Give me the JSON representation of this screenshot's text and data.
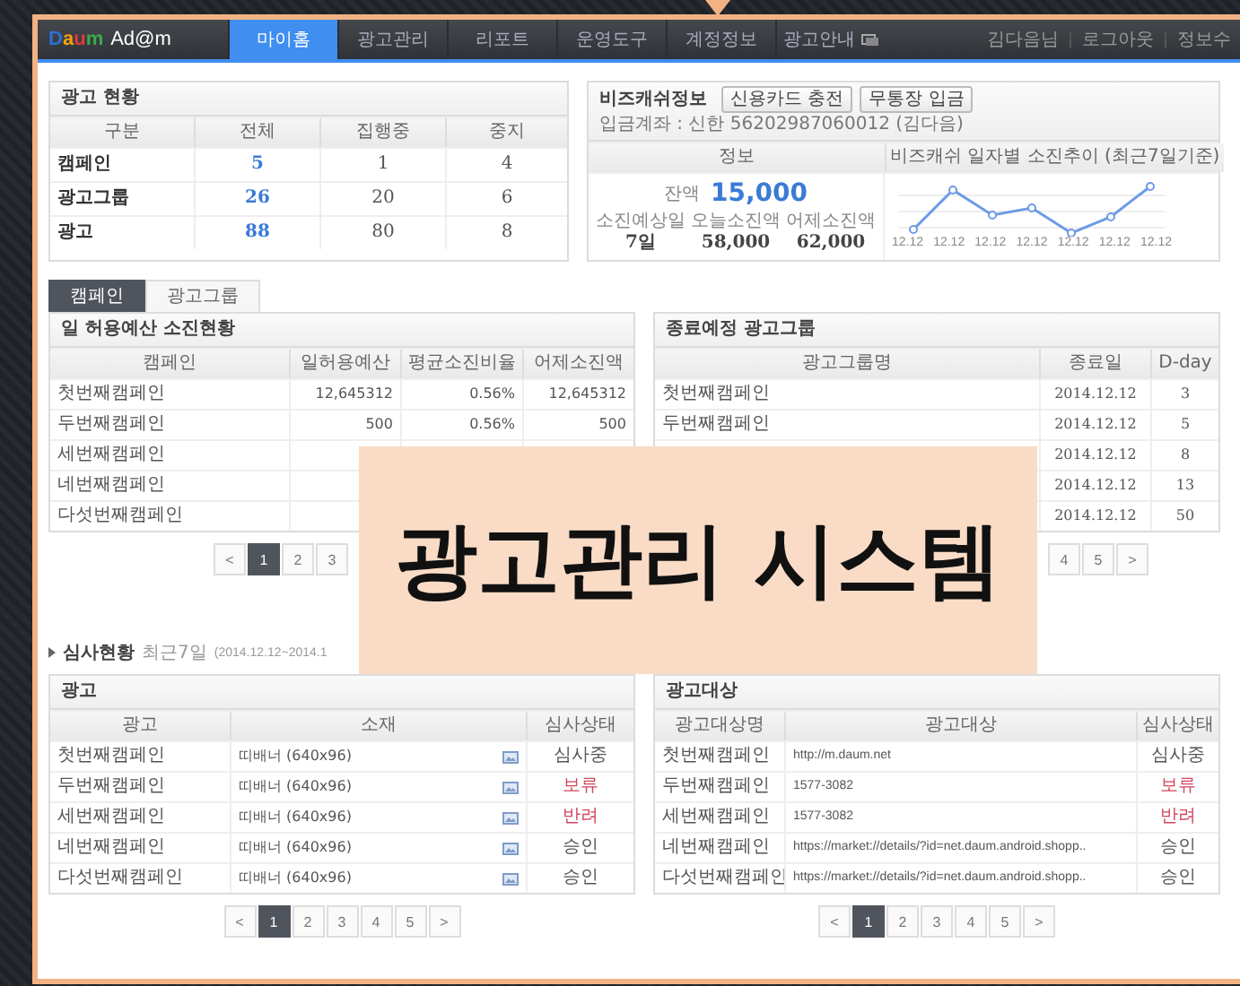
{
  "nav": {
    "logo": "Daum",
    "product": "Ad@m",
    "items": [
      {
        "label": "마이홈",
        "selected": true,
        "has_icon": false
      },
      {
        "label": "광고관리",
        "selected": false,
        "has_icon": false
      },
      {
        "label": "리포트",
        "selected": false,
        "has_icon": false
      },
      {
        "label": "운영도구",
        "selected": false,
        "has_icon": false
      },
      {
        "label": "계정정보",
        "selected": false,
        "has_icon": false
      },
      {
        "label": "광고안내",
        "selected": false,
        "has_icon": true
      }
    ],
    "user_links": [
      "김다음님",
      "로그아웃",
      "정보수"
    ]
  },
  "ad_status": {
    "title": "광고 현황",
    "columns": [
      "구분",
      "전체",
      "집행중",
      "중지"
    ],
    "rows": [
      [
        "캠페인",
        "5",
        "1",
        "4"
      ],
      [
        "광고그룹",
        "26",
        "20",
        "6"
      ],
      [
        "광고",
        "88",
        "80",
        "8"
      ]
    ]
  },
  "bizcash": {
    "title": "비즈캐쉬정보",
    "buttons": [
      "신용카드 충전",
      "무통장 입금"
    ],
    "account": "입금계좌 : 신한 56202987060012 (김다음)",
    "columns": [
      "정보",
      "비즈캐쉬 일자별 소진추이 (최근7일기준)"
    ],
    "balance_label": "잔액",
    "balance": "15,000",
    "stats": [
      {
        "label": "소진예상일",
        "value": "7일"
      },
      {
        "label": "오늘소진액",
        "value": "58,000"
      },
      {
        "label": "어제소진액",
        "value": "62,000"
      }
    ],
    "trend_labels": [
      "12.12",
      "12.12",
      "12.12",
      "12.12",
      "12.12",
      "12.12",
      "12.12"
    ]
  },
  "budget_tabs": [
    {
      "label": "캠페인",
      "selected": true
    },
    {
      "label": "광고그룹",
      "selected": false
    }
  ],
  "budget_table": {
    "title": "일 허용예산 소진현황",
    "columns": [
      "캠페인",
      "일허용예산",
      "평균소진비율",
      "어제소진액"
    ],
    "rows": [
      [
        "첫번째캠페인",
        "12,645312",
        "0.56%",
        "12,645312"
      ],
      [
        "두번째캠페인",
        "500",
        "0.56%",
        "500"
      ],
      [
        "세번째캠페인"
      ],
      [
        "네번째캠페인"
      ],
      [
        "다섯번째캠페인"
      ]
    ]
  },
  "budget_pagination": {
    "prev": "<",
    "pages": [
      {
        "label": "1",
        "selected": true
      },
      {
        "label": "2",
        "selected": false
      },
      {
        "label": "3",
        "selected": false
      }
    ]
  },
  "ending_groups": {
    "title": "종료예정 광고그룹",
    "columns": [
      "광고그룹명",
      "종료일",
      "D-day"
    ],
    "rows": [
      [
        "첫번째캠페인",
        "2014.12.12",
        "3"
      ],
      [
        "두번째캠페인",
        "2014.12.12",
        "5"
      ],
      [
        null,
        "2014.12.12",
        "8"
      ],
      [
        null,
        "2014.12.12",
        "13"
      ],
      [
        null,
        "2014.12.12",
        "50"
      ]
    ]
  },
  "ending_pagination": {
    "next": ">",
    "pages": [
      {
        "label": "4",
        "selected": false
      },
      {
        "label": "5",
        "selected": false
      }
    ]
  },
  "review": {
    "title": "심사현황",
    "period": "최근7일",
    "range": "(2014.12.12~2014.1"
  },
  "review_ads": {
    "title": "광고",
    "columns": [
      "광고",
      "소재",
      "심사상태"
    ],
    "rows": [
      {
        "name": "첫번째캠페인",
        "creative": "띠배너 (640x96)",
        "status": "심사중",
        "color": "#555555"
      },
      {
        "name": "두번째캠페인",
        "creative": "띠배너 (640x96)",
        "status": "보류",
        "color": "#d2465e"
      },
      {
        "name": "세번째캠페인",
        "creative": "띠배너 (640x96)",
        "status": "반려",
        "color": "#d2465e"
      },
      {
        "name": "네번째캠페인",
        "creative": "띠배너 (640x96)",
        "status": "승인",
        "color": "#555555"
      },
      {
        "name": "다섯번째캠페인",
        "creative": "띠배너 (640x96)",
        "status": "승인",
        "color": "#555555"
      }
    ]
  },
  "review_ads_pagination": {
    "prev": "<",
    "next": ">",
    "pages": [
      {
        "label": "1",
        "selected": true
      },
      {
        "label": "2",
        "selected": false
      },
      {
        "label": "3",
        "selected": false
      },
      {
        "label": "4",
        "selected": false
      },
      {
        "label": "5",
        "selected": false
      }
    ]
  },
  "review_targets": {
    "title": "광고대상",
    "columns": [
      "광고대상명",
      "광고대상",
      "심사상태"
    ],
    "rows": [
      {
        "name": "첫번째캠페인",
        "target": "http://m.daum.net",
        "status": "심사중",
        "color": "#555555"
      },
      {
        "name": "두번째캠페인",
        "target": "1577-3082",
        "status": "보류",
        "color": "#d2465e"
      },
      {
        "name": "세번째캠페인",
        "target": "1577-3082",
        "status": "반려",
        "color": "#d2465e"
      },
      {
        "name": "네번째캠페인",
        "target": "https://market://details/?id=net.daum.android.shopp..",
        "status": "승인",
        "color": "#555555"
      },
      {
        "name": "다섯번째캠페인",
        "target": "https://market://details/?id=net.daum.android.shopp..",
        "status": "승인",
        "color": "#555555"
      }
    ]
  },
  "review_targets_pagination": {
    "prev": "<",
    "next": ">",
    "pages": [
      {
        "label": "1",
        "selected": true
      },
      {
        "label": "2",
        "selected": false
      },
      {
        "label": "3",
        "selected": false
      },
      {
        "label": "4",
        "selected": false
      },
      {
        "label": "5",
        "selected": false
      }
    ]
  },
  "overlay_title": "광고관리 시스템"
}
